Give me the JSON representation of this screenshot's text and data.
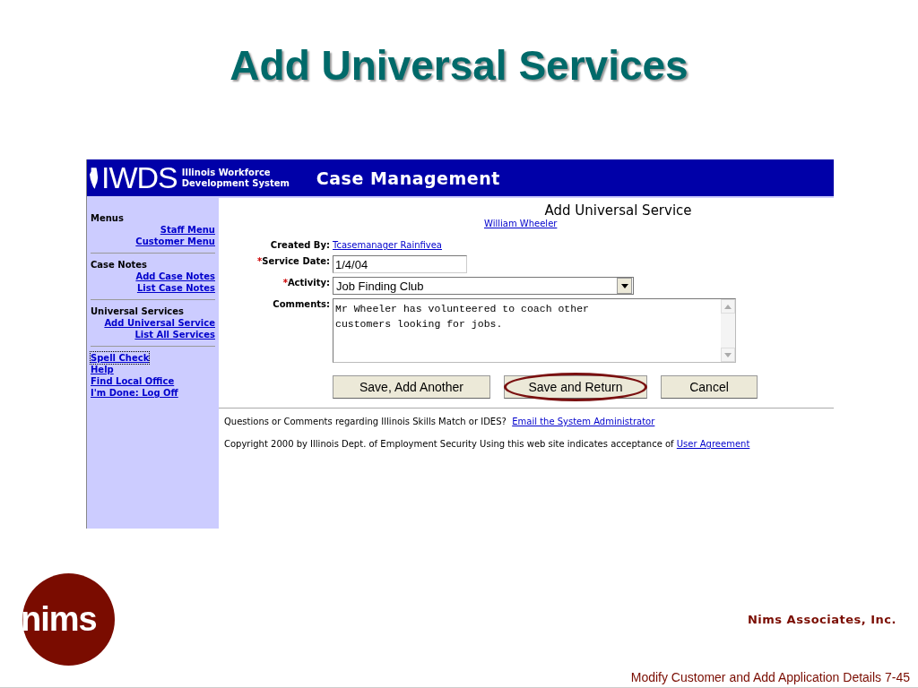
{
  "slide": {
    "title": "Add Universal Services"
  },
  "app": {
    "logo": "IWDS",
    "logo_subtitle": [
      "Illinois Workforce",
      "Development System"
    ],
    "header_title": "Case Management"
  },
  "sidebar": {
    "sections": [
      {
        "heading": "Menus",
        "links": [
          "Staff Menu",
          "Customer Menu"
        ]
      },
      {
        "heading": "Case Notes",
        "links": [
          "Add Case Notes",
          "List Case Notes"
        ]
      },
      {
        "heading": "Universal Services",
        "links": [
          "Add Universal Service",
          "List All Services"
        ]
      }
    ],
    "bottom_links": [
      {
        "label": "Spell Check",
        "focused": true
      },
      {
        "label": "Help",
        "focused": false
      },
      {
        "label": "Find Local Office",
        "focused": false
      },
      {
        "label": "I'm Done: Log Off",
        "focused": false
      }
    ]
  },
  "form": {
    "title": "Add Universal Service",
    "customer_link": "William Wheeler",
    "fields": [
      {
        "kind": "link",
        "label": "Created By:",
        "required": false,
        "value": "Tcasemanager Rainfivea"
      },
      {
        "kind": "text",
        "label": "Service Date:",
        "required": true,
        "value": "1/4/04"
      },
      {
        "kind": "select",
        "label": "Activity:",
        "required": true,
        "value": "Job Finding Club"
      },
      {
        "kind": "textarea",
        "label": "Comments:",
        "required": false,
        "value": "Mr Wheeler has volunteered to coach other\ncustomers looking for jobs."
      }
    ],
    "required_mark": "*",
    "buttons": [
      {
        "label": "Save, Add Another",
        "highlighted": false
      },
      {
        "label": "Save and Return",
        "highlighted": true
      },
      {
        "label": "Cancel",
        "highlighted": false
      }
    ]
  },
  "page_footer": {
    "question": "Questions or Comments regarding Illinois Skills Match or IDES?",
    "question_link": "Email the System Administrator",
    "copyright": "Copyright 2000 by Illinois Dept. of Employment Security Using this web site indicates acceptance of",
    "copyright_link": "User Agreement"
  },
  "slide_footer": {
    "logo": "nims",
    "company": "Nims Associates, Inc.",
    "caption": "Modify Customer and Add Application Details 7-45"
  }
}
